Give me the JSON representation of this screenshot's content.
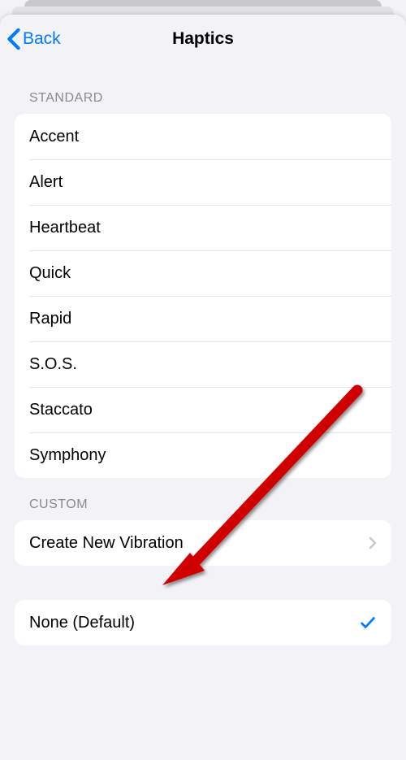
{
  "nav": {
    "back_label": "Back",
    "title": "Haptics"
  },
  "sections": {
    "standard": {
      "header": "Standard",
      "items": [
        {
          "label": "Accent"
        },
        {
          "label": "Alert"
        },
        {
          "label": "Heartbeat"
        },
        {
          "label": "Quick"
        },
        {
          "label": "Rapid"
        },
        {
          "label": "S.O.S."
        },
        {
          "label": "Staccato"
        },
        {
          "label": "Symphony"
        }
      ]
    },
    "custom": {
      "header": "Custom",
      "create_label": "Create New Vibration"
    },
    "none": {
      "label": "None (Default)",
      "selected": true
    }
  }
}
